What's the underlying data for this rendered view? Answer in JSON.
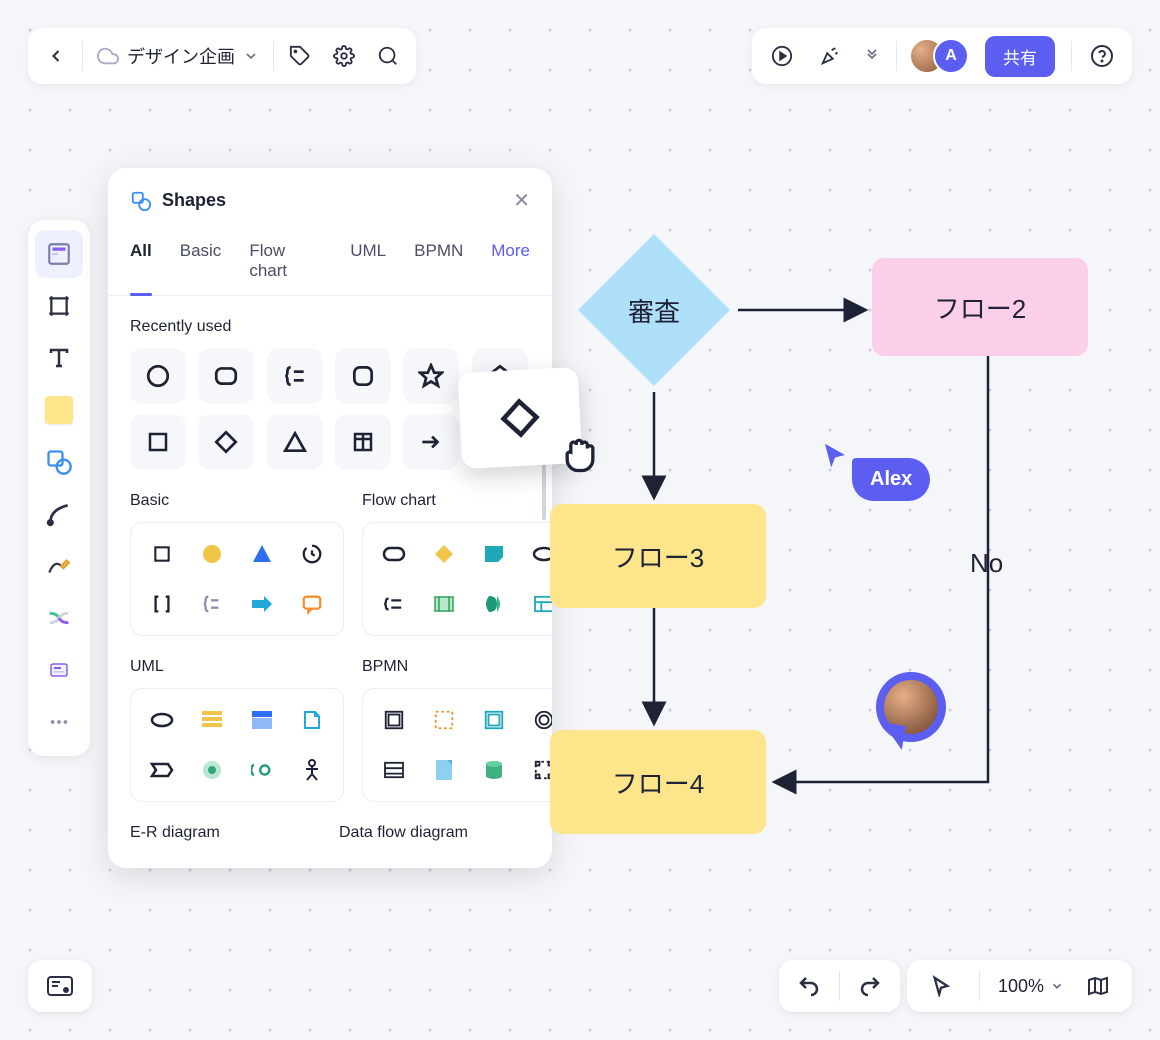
{
  "header": {
    "doc_title": "デザイン企画"
  },
  "topright": {
    "avatar_initial": "A",
    "share_label": "共有"
  },
  "shapes_panel": {
    "title": "Shapes",
    "tabs": [
      "All",
      "Basic",
      "Flow chart",
      "UML",
      "BPMN"
    ],
    "more_label": "More",
    "section_recent": "Recently used",
    "section_basic": "Basic",
    "section_flow": "Flow chart",
    "section_uml": "UML",
    "section_bpmn": "BPMN",
    "section_er": "E-R diagram",
    "section_dfd": "Data flow diagram"
  },
  "flowchart": {
    "diamond": "審査",
    "flow2": "フロー2",
    "flow3": "フロー3",
    "flow4": "フロー4",
    "edge_no": "No"
  },
  "collab": {
    "alex": "Alex"
  },
  "bottom": {
    "zoom": "100%"
  }
}
